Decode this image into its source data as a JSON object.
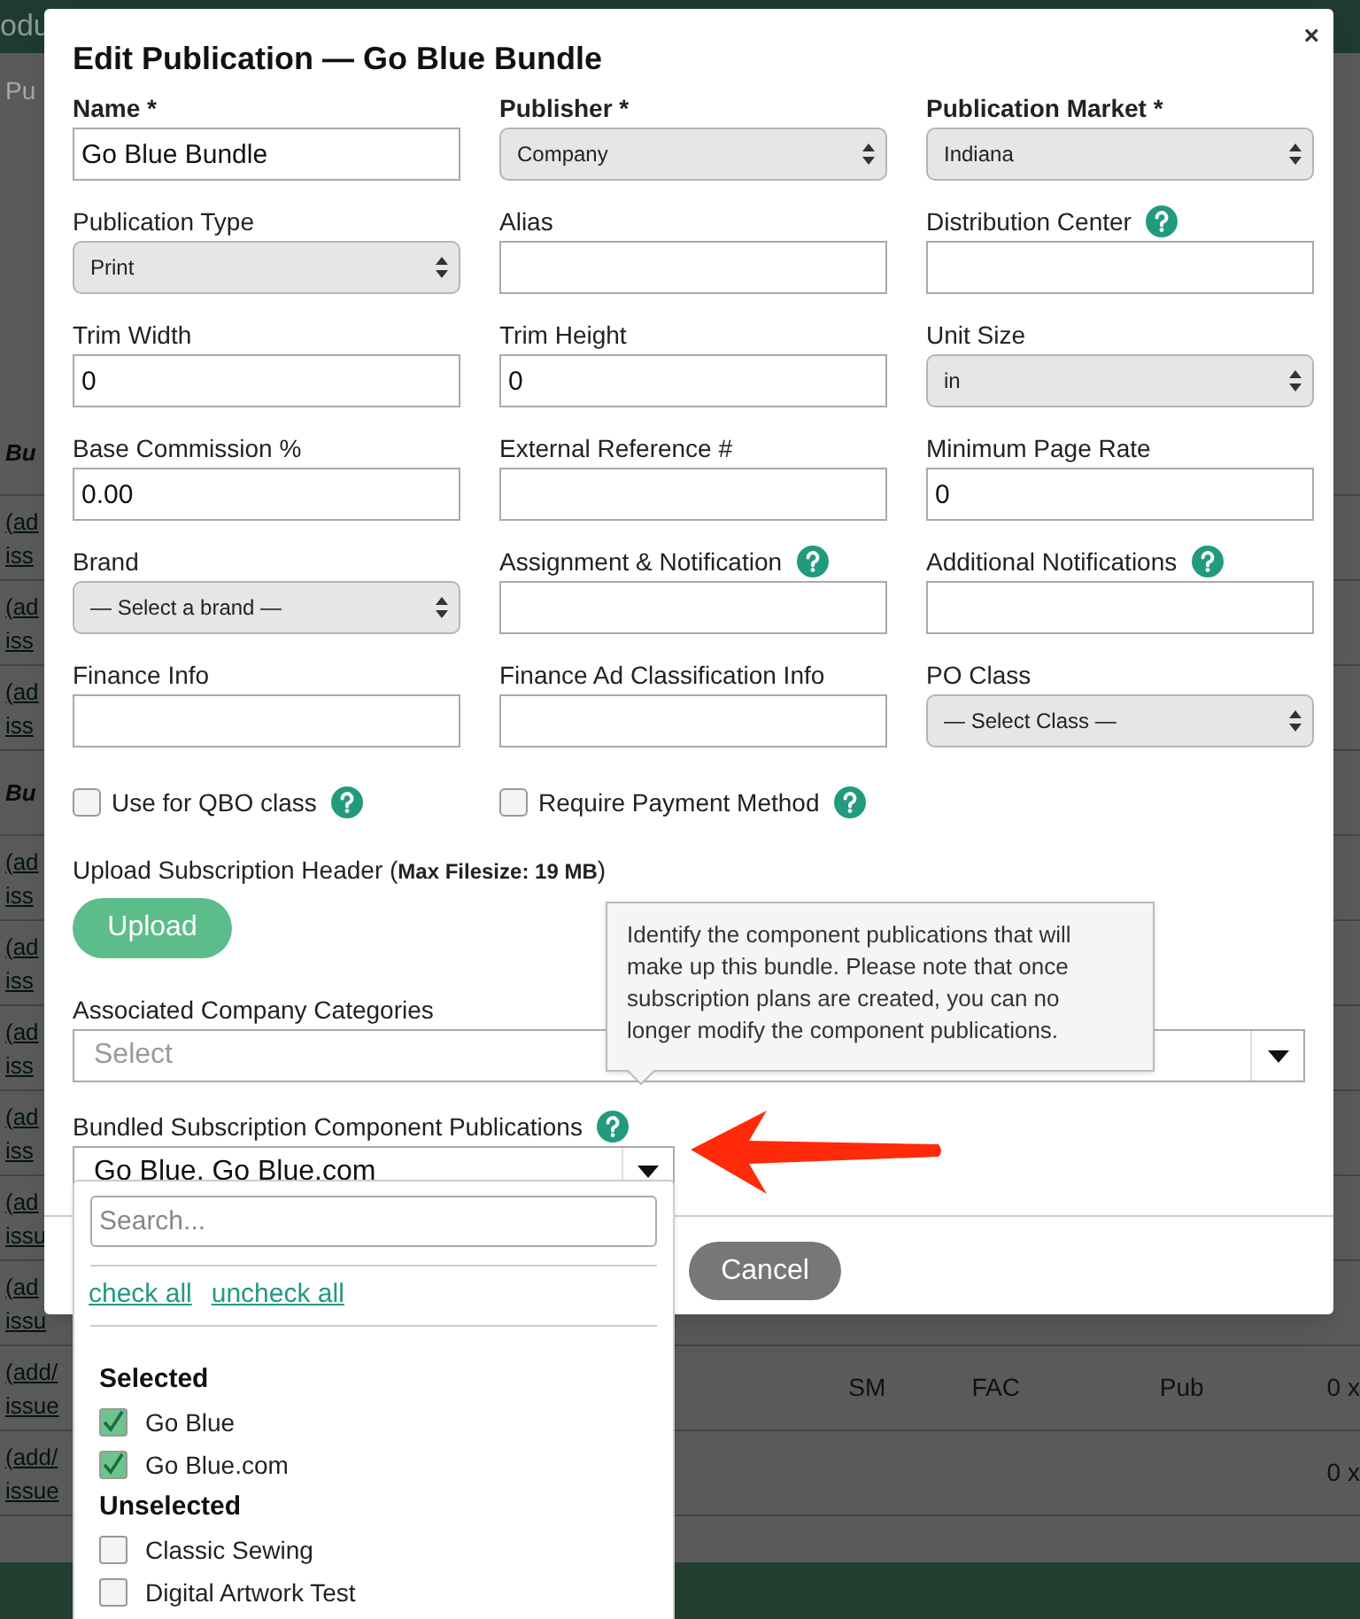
{
  "background": {
    "header_fragment": "odu",
    "subtitle_fragment": "Pu",
    "rows": [
      {
        "left": [
          "Bu"
        ],
        "italic": true
      },
      {
        "left": [
          "(ad",
          "iss"
        ]
      },
      {
        "left": [
          "(ad",
          "iss"
        ]
      },
      {
        "left": [
          "(ad",
          "iss"
        ]
      },
      {
        "left": [
          "Bu"
        ],
        "italic": true
      },
      {
        "left": [
          "(ad",
          "iss"
        ]
      },
      {
        "left": [
          "(ad",
          "iss"
        ]
      },
      {
        "left": [
          "(ad",
          "iss"
        ]
      },
      {
        "left": [
          "(ad",
          "iss"
        ]
      },
      {
        "left": [
          "(ad",
          "issu"
        ]
      },
      {
        "left": [
          "(ad",
          "issu"
        ]
      },
      {
        "left": [
          "(add/",
          "issue"
        ],
        "cells": [
          "SM",
          "FAC",
          "Pub",
          "0 x"
        ]
      },
      {
        "left": [
          "(add/",
          "issue"
        ],
        "cells": [
          "",
          "",
          "",
          "0 x"
        ]
      }
    ]
  },
  "dialog": {
    "title": "Edit Publication — Go Blue Bundle",
    "close": "×",
    "fields": [
      {
        "kind": "text",
        "label": "Name *",
        "bold": true,
        "value": "Go Blue Bundle"
      },
      {
        "kind": "select",
        "label": "Publisher *",
        "bold": true,
        "value": "Company"
      },
      {
        "kind": "select",
        "label": "Publication Market *",
        "bold": true,
        "value": "Indiana"
      },
      {
        "kind": "select",
        "label": "Publication Type",
        "bold": false,
        "value": "Print"
      },
      {
        "kind": "text",
        "label": "Alias",
        "bold": false
      },
      {
        "kind": "text",
        "label": "Distribution Center",
        "bold": false,
        "help": true
      },
      {
        "kind": "text",
        "label": "Trim Width",
        "bold": false,
        "value": "0"
      },
      {
        "kind": "text",
        "label": "Trim Height",
        "bold": false,
        "value": "0"
      },
      {
        "kind": "select",
        "label": "Unit Size",
        "bold": false,
        "value": "in"
      },
      {
        "kind": "text",
        "label": "Base Commission %",
        "bold": false,
        "value": "0.00"
      },
      {
        "kind": "text",
        "label": "External Reference #",
        "bold": false
      },
      {
        "kind": "text",
        "label": "Minimum Page Rate",
        "bold": false,
        "value": "0"
      },
      {
        "kind": "select",
        "label": "Brand",
        "bold": false,
        "value": "— Select a brand —"
      },
      {
        "kind": "text",
        "label": "Assignment & Notification",
        "bold": false,
        "help": true
      },
      {
        "kind": "text",
        "label": "Additional Notifications",
        "bold": false,
        "help": true
      },
      {
        "kind": "text",
        "label": "Finance Info",
        "bold": false
      },
      {
        "kind": "text",
        "label": "Finance Ad Classification Info",
        "bold": false
      },
      {
        "kind": "select",
        "label": "PO Class",
        "bold": false,
        "value": "— Select Class —"
      }
    ],
    "checkboxes": [
      {
        "label": "Use for QBO class",
        "checked": false,
        "help": true
      },
      {
        "label": "Require Payment Method",
        "checked": false,
        "help": true
      }
    ],
    "upload": {
      "label": "Upload Subscription Header (**Max Filesize: 19 MB**)",
      "button": "Upload"
    },
    "categories": {
      "label": "Associated Company Categories",
      "placeholder": "Select"
    },
    "components": {
      "label": "Bundled Subscription Component Publications",
      "value": "Go Blue, Go Blue.com",
      "help": true
    },
    "buttons": [
      "Cancel"
    ]
  },
  "tooltip": "Identify the component publications that will make up this bundle. Please note that once subscription plans are created, you can no longer modify the component publications.",
  "dropdown": {
    "search_placeholder": "Search...",
    "links": [
      "check all",
      "uncheck all"
    ],
    "groups": [
      {
        "title": "Selected",
        "items": [
          {
            "label": "Go Blue",
            "checked": true
          },
          {
            "label": "Go Blue.com",
            "checked": true
          }
        ]
      },
      {
        "title": "Unselected",
        "items": [
          {
            "label": "Classic Sewing",
            "checked": false
          },
          {
            "label": "Digital Artwork Test",
            "checked": false
          }
        ]
      }
    ]
  }
}
